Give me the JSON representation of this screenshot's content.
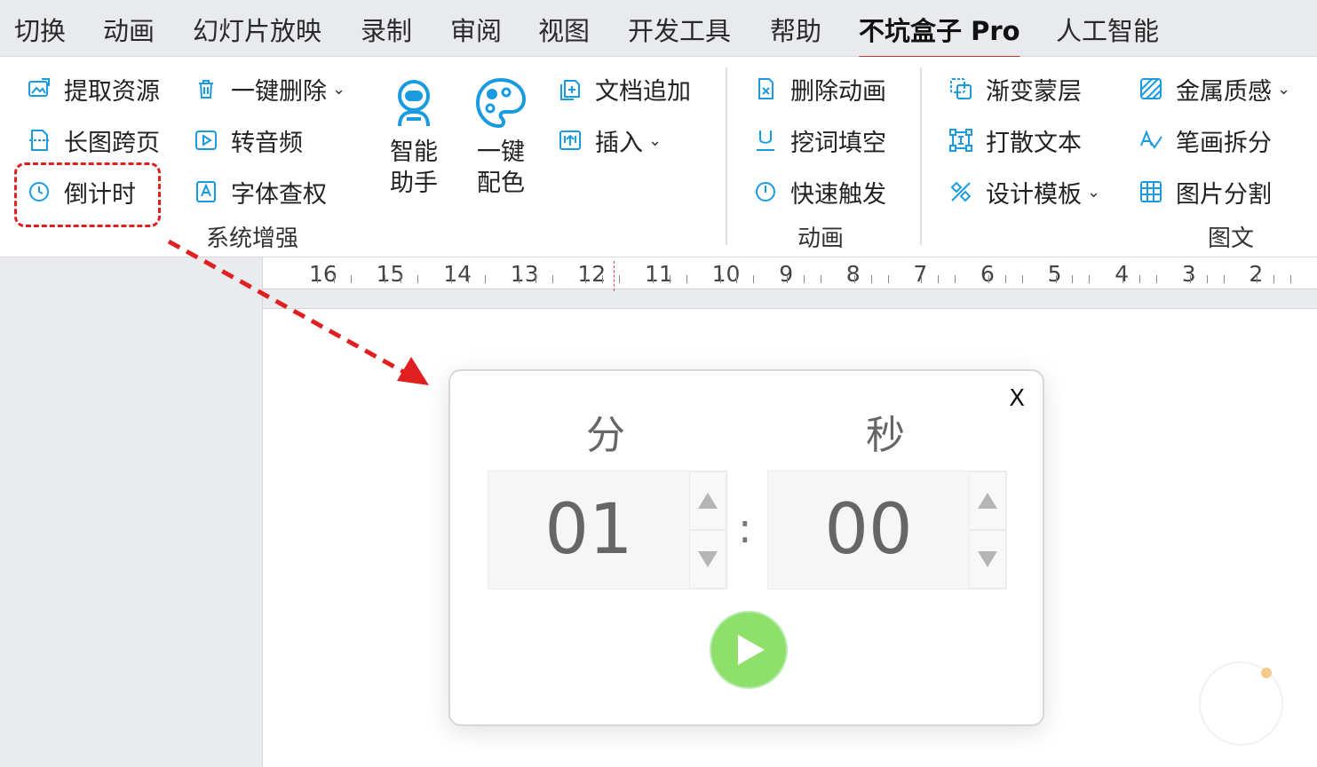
{
  "menu": {
    "tabs": [
      "切换",
      "动画",
      "幻灯片放映",
      "录制",
      "审阅",
      "视图",
      "开发工具",
      "帮助",
      "不坑盒子 Pro",
      "人工智能"
    ],
    "active_tab": "不坑盒子 Pro"
  },
  "ribbon": {
    "system": {
      "extract": "提取资源",
      "long_image": "长图跨页",
      "countdown": "倒计时",
      "one_key_delete": "一键删除",
      "to_audio": "转音频",
      "font_check": "字体查权",
      "group_label": "系统增强"
    },
    "smart_assistant": "智能\n助手",
    "one_key_color": "一键\n配色",
    "doc_append": "文档追加",
    "insert": "插入",
    "animation": {
      "delete_anim": "删除动画",
      "fill_blank": "挖词填空",
      "quick_trigger": "快速触发",
      "group_label": "动画"
    },
    "graphic": {
      "gradient_mask": "渐变蒙层",
      "scatter_text": "打散文本",
      "design_template": "设计模板",
      "metal_texture": "金属质感",
      "stroke_split": "笔画拆分",
      "image_split": "图片分割",
      "group_label": "图文"
    }
  },
  "ruler": {
    "labels": [
      "16",
      "15",
      "14",
      "13",
      "12",
      "11",
      "10",
      "9",
      "8",
      "7",
      "6",
      "5",
      "4",
      "3",
      "2"
    ]
  },
  "timer": {
    "close": "X",
    "minutes_label": "分",
    "seconds_label": "秒",
    "minutes": "01",
    "seconds": "00",
    "separator": ":"
  },
  "colors": {
    "accent_blue": "#1a9be0",
    "highlight_red": "#e02020",
    "play_green": "#8ee06a"
  }
}
